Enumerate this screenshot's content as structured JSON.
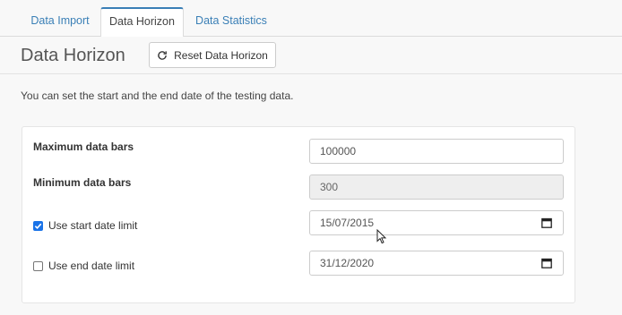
{
  "tabs": {
    "import": "Data Import",
    "horizon": "Data Horizon",
    "statistics": "Data Statistics"
  },
  "header": {
    "title": "Data Horizon",
    "reset_label": "Reset Data Horizon"
  },
  "intro_text": "You can set the start and the end date of the testing data.",
  "form": {
    "max_bars_label": "Maximum data bars",
    "max_bars_value": "100000",
    "min_bars_label": "Minimum data bars",
    "min_bars_value": "300",
    "start_label": "Use start date limit",
    "start_checked": true,
    "start_date": "15/07/2015",
    "end_label": "Use end date limit",
    "end_checked": false,
    "end_date": "31/12/2020"
  },
  "colors": {
    "accent": "#3a7fb6",
    "checkbox": "#1a73e8"
  },
  "icons": [
    "refresh-icon",
    "calendar-icon",
    "check-icon",
    "mouse-cursor-icon"
  ]
}
